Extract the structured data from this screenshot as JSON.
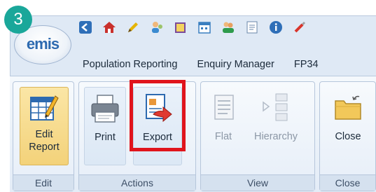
{
  "step": "3",
  "logo": {
    "text": "emis"
  },
  "quick_access": [
    {
      "name": "back-icon",
      "color": "#2f6fb8"
    },
    {
      "name": "home-icon",
      "color": "#c9302c"
    },
    {
      "name": "pencil-icon",
      "color": "#e5b400"
    },
    {
      "name": "users-icon",
      "color": "#3a8ad0"
    },
    {
      "name": "notepad-icon",
      "color": "#7a4a9a"
    },
    {
      "name": "calendar-icon",
      "color": "#3a7fc0"
    },
    {
      "name": "group-icon",
      "color": "#2e9b4c"
    },
    {
      "name": "document-icon",
      "color": "#6a86a8"
    },
    {
      "name": "info-icon",
      "color": "#2f6fb8"
    },
    {
      "name": "brush-icon",
      "color": "#d9342b"
    }
  ],
  "tabs": [
    "Population Reporting",
    "Enquiry Manager",
    "FP34"
  ],
  "groups": [
    {
      "label": "Edit"
    },
    {
      "label": "Actions"
    },
    {
      "label": "View"
    },
    {
      "label": "Close"
    }
  ],
  "buttons": {
    "edit_report": {
      "label_line1": "Edit",
      "label_line2": "Report"
    },
    "print": {
      "label": "Print"
    },
    "export": {
      "label": "Export"
    },
    "flat": {
      "label": "Flat"
    },
    "hierarchy": {
      "label": "Hierarchy"
    },
    "close": {
      "label": "Close"
    }
  },
  "colors": {
    "highlight": "#e0141c",
    "badge": "#1aa79a"
  }
}
